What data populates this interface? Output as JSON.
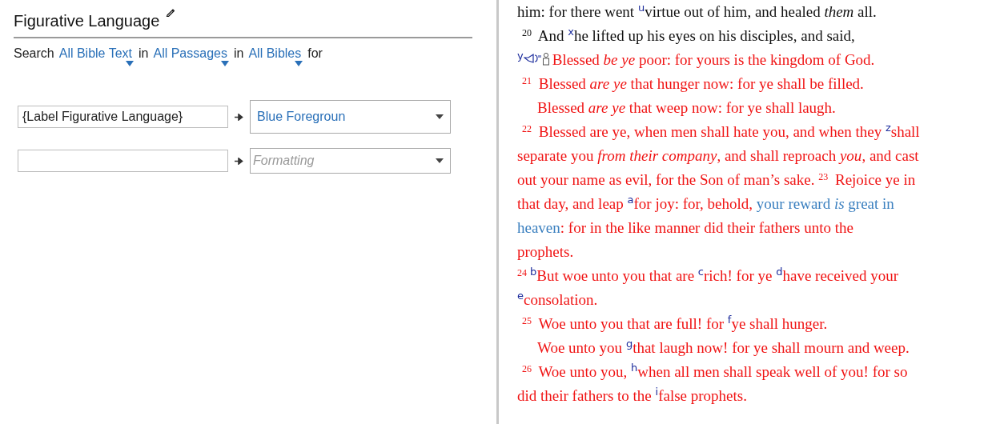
{
  "panel": {
    "title": "Figurative Language",
    "search": [
      {
        "kind": "text",
        "text": "Search"
      },
      {
        "kind": "menu",
        "text": "All Bible Text"
      },
      {
        "kind": "text",
        "text": "in"
      },
      {
        "kind": "menu",
        "text": "All Passages"
      },
      {
        "kind": "text",
        "text": "in"
      },
      {
        "kind": "menu",
        "text": "All Bibles"
      },
      {
        "kind": "text",
        "text": "for"
      }
    ],
    "rules": [
      {
        "pattern": "{Label Figurative Language}",
        "format": {
          "value": "Blue Foregroun"
        }
      },
      {
        "format": {
          "placeholder": "Formatting"
        }
      }
    ]
  },
  "passage": [
    {
      "kind": "flush",
      "segments": [
        {
          "kind": "text",
          "text": "him: for there went ",
          "color": "#111111"
        },
        {
          "kind": "note",
          "text": "u"
        },
        {
          "kind": "text",
          "text": "virtue out of him, and healed *them* all.",
          "color": "#111111"
        }
      ]
    },
    {
      "kind": "verse",
      "segments": [
        {
          "kind": "verse",
          "text": "20",
          "color": "#111111"
        },
        {
          "kind": "text",
          "text": " And ",
          "color": "#111111"
        },
        {
          "kind": "note",
          "text": "x"
        },
        {
          "kind": "text",
          "text": "he lifted up his eyes on his disciples, and said,",
          "color": "#111111"
        }
      ]
    },
    {
      "kind": "flush",
      "segments": [
        {
          "kind": "note",
          "text": "y"
        },
        {
          "kind": "icons"
        },
        {
          "kind": "text",
          "text": "Blessed *be ye* poor: for yours is the kingdom of God.",
          "color": "#f01414"
        }
      ]
    },
    {
      "kind": "verse",
      "segments": [
        {
          "kind": "verse",
          "text": "21",
          "color": "#f01414"
        },
        {
          "kind": "text",
          "text": " Blessed *are ye* that hunger now: for ye shall be filled.",
          "color": "#f01414"
        }
      ]
    },
    {
      "kind": "continuation",
      "segments": [
        {
          "kind": "text",
          "text": "Blessed *are ye* that weep now: for ye shall laugh.",
          "color": "#f01414"
        }
      ]
    },
    {
      "kind": "verse",
      "segments": [
        {
          "kind": "verse",
          "text": "22",
          "color": "#f01414"
        },
        {
          "kind": "text",
          "text": " Blessed are ye, when men shall hate you, and when they ",
          "color": "#f01414"
        },
        {
          "kind": "note",
          "text": "z"
        },
        {
          "kind": "text",
          "text": "shall",
          "color": "#f01414"
        }
      ]
    },
    {
      "kind": "flush",
      "segments": [
        {
          "kind": "text",
          "text": "separate you *from their company*, and shall reproach *you*, and cast",
          "color": "#f01414"
        }
      ]
    },
    {
      "kind": "flush",
      "segments": [
        {
          "kind": "text",
          "text": "out your name as evil, for the Son of man’s sake. ",
          "color": "#f01414"
        },
        {
          "kind": "verse",
          "text": "23",
          "color": "#f01414"
        },
        {
          "kind": "text",
          "text": " Rejoice ye in",
          "color": "#f01414"
        }
      ]
    },
    {
      "kind": "flush",
      "segments": [
        {
          "kind": "text",
          "text": "that day, and leap ",
          "color": "#f01414"
        },
        {
          "kind": "note",
          "text": "a"
        },
        {
          "kind": "text",
          "text": "for joy: for, behold, ",
          "color": "#f01414"
        },
        {
          "kind": "text",
          "text": "your reward *is* great in",
          "color": "#3a7fbf"
        }
      ]
    },
    {
      "kind": "flush",
      "segments": [
        {
          "kind": "text",
          "text": "heaven",
          "color": "#3a7fbf"
        },
        {
          "kind": "text",
          "text": ": for in the like manner did their fathers unto the",
          "color": "#f01414"
        }
      ]
    },
    {
      "kind": "flush",
      "segments": [
        {
          "kind": "text",
          "text": "prophets.",
          "color": "#f01414"
        }
      ]
    },
    {
      "kind": "flush",
      "segments": [
        {
          "kind": "verse",
          "text": "24",
          "color": "#f01414"
        },
        {
          "kind": "note",
          "text": "b"
        },
        {
          "kind": "text",
          "text": "But woe unto you that are ",
          "color": "#f01414"
        },
        {
          "kind": "note",
          "text": "c"
        },
        {
          "kind": "text",
          "text": "rich! for ye ",
          "color": "#f01414"
        },
        {
          "kind": "note",
          "text": "d"
        },
        {
          "kind": "text",
          "text": "have received your",
          "color": "#f01414"
        }
      ]
    },
    {
      "kind": "flush",
      "segments": [
        {
          "kind": "note",
          "text": "e"
        },
        {
          "kind": "text",
          "text": "consolation.",
          "color": "#f01414"
        }
      ]
    },
    {
      "kind": "verse",
      "segments": [
        {
          "kind": "verse",
          "text": "25",
          "color": "#f01414"
        },
        {
          "kind": "text",
          "text": " Woe unto you that are full! for ",
          "color": "#f01414"
        },
        {
          "kind": "note",
          "text": "f"
        },
        {
          "kind": "text",
          "text": "ye shall hunger.",
          "color": "#f01414"
        }
      ]
    },
    {
      "kind": "continuation",
      "segments": [
        {
          "kind": "text",
          "text": "Woe unto you ",
          "color": "#f01414"
        },
        {
          "kind": "note",
          "text": "g"
        },
        {
          "kind": "text",
          "text": "that laugh now! for ye shall mourn and weep.",
          "color": "#f01414"
        }
      ]
    },
    {
      "kind": "verse",
      "segments": [
        {
          "kind": "verse",
          "text": "26",
          "color": "#f01414"
        },
        {
          "kind": "text",
          "text": " Woe unto you, ",
          "color": "#f01414"
        },
        {
          "kind": "note",
          "text": "h"
        },
        {
          "kind": "text",
          "text": "when all men shall speak well of you! for so",
          "color": "#f01414"
        }
      ]
    },
    {
      "kind": "flush",
      "segments": [
        {
          "kind": "text",
          "text": "did their fathers to the ",
          "color": "#f01414"
        },
        {
          "kind": "note",
          "text": "i"
        },
        {
          "kind": "text",
          "text": "false prophets.",
          "color": "#f01414"
        }
      ]
    }
  ]
}
